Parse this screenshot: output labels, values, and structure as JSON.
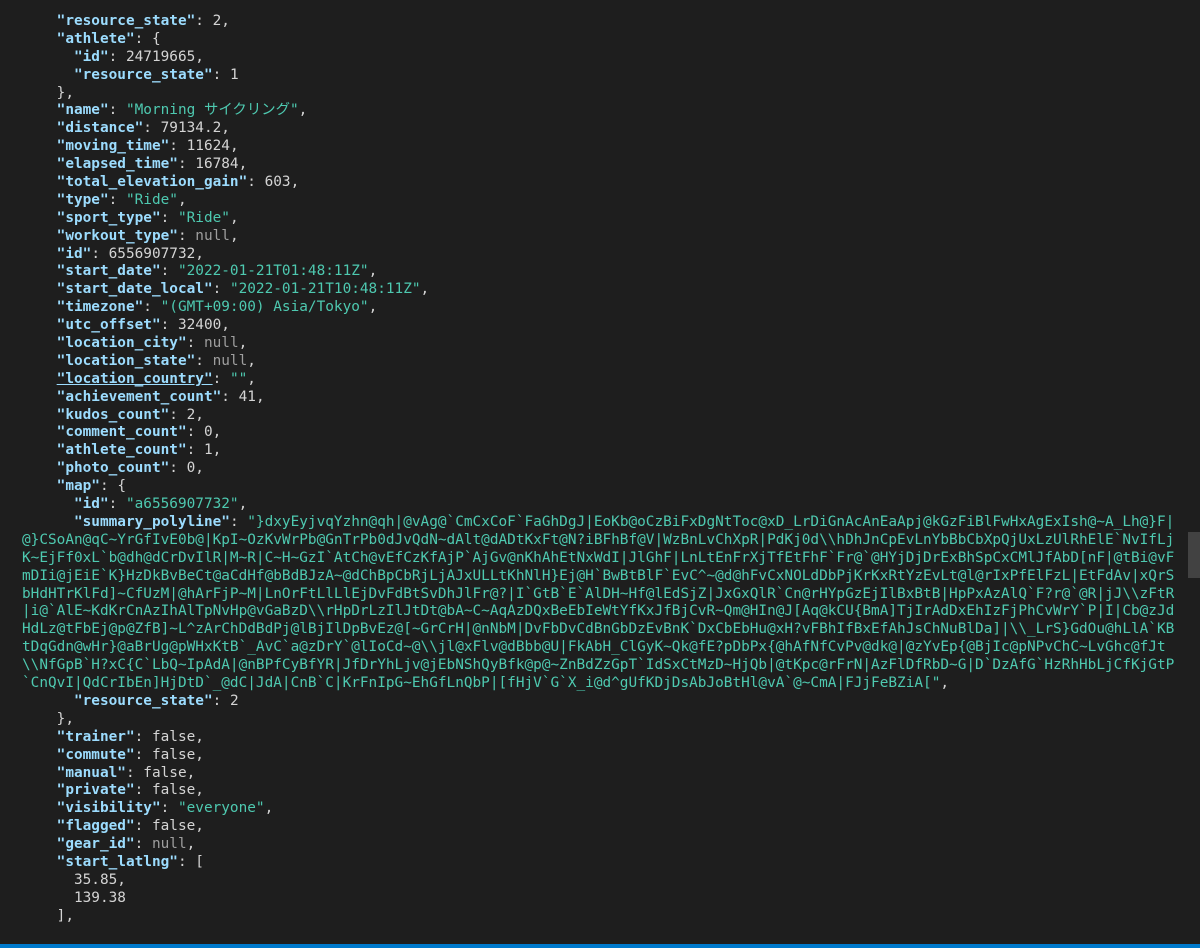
{
  "lines": [
    {
      "indent": "    ",
      "key": "\"resource_state\"",
      "sep": ": ",
      "value": "2",
      "vtype": "n",
      "tail": ","
    },
    {
      "indent": "    ",
      "key": "\"athlete\"",
      "sep": ": ",
      "value": "{",
      "vtype": "p",
      "tail": ""
    },
    {
      "indent": "      ",
      "key": "\"id\"",
      "sep": ": ",
      "value": "24719665",
      "vtype": "n",
      "tail": ","
    },
    {
      "indent": "      ",
      "key": "\"resource_state\"",
      "sep": ": ",
      "value": "1",
      "vtype": "n",
      "tail": ""
    },
    {
      "indent": "    ",
      "key": "",
      "sep": "",
      "value": "},",
      "vtype": "p",
      "tail": ""
    },
    {
      "indent": "    ",
      "key": "\"name\"",
      "sep": ": ",
      "value": "\"Morning サイクリング\"",
      "vtype": "s",
      "tail": ","
    },
    {
      "indent": "    ",
      "key": "\"distance\"",
      "sep": ": ",
      "value": "79134.2",
      "vtype": "n",
      "tail": ","
    },
    {
      "indent": "    ",
      "key": "\"moving_time\"",
      "sep": ": ",
      "value": "11624",
      "vtype": "n",
      "tail": ","
    },
    {
      "indent": "    ",
      "key": "\"elapsed_time\"",
      "sep": ": ",
      "value": "16784",
      "vtype": "n",
      "tail": ","
    },
    {
      "indent": "    ",
      "key": "\"total_elevation_gain\"",
      "sep": ": ",
      "value": "603",
      "vtype": "n",
      "tail": ","
    },
    {
      "indent": "    ",
      "key": "\"type\"",
      "sep": ": ",
      "value": "\"Ride\"",
      "vtype": "s",
      "tail": ","
    },
    {
      "indent": "    ",
      "key": "\"sport_type\"",
      "sep": ": ",
      "value": "\"Ride\"",
      "vtype": "s",
      "tail": ","
    },
    {
      "indent": "    ",
      "key": "\"workout_type\"",
      "sep": ": ",
      "value": "null",
      "vtype": "nl",
      "tail": ","
    },
    {
      "indent": "    ",
      "key": "\"id\"",
      "sep": ": ",
      "value": "6556907732",
      "vtype": "n",
      "tail": ","
    },
    {
      "indent": "    ",
      "key": "\"start_date\"",
      "sep": ": ",
      "value": "\"2022-01-21T01:48:11Z\"",
      "vtype": "s",
      "tail": ","
    },
    {
      "indent": "    ",
      "key": "\"start_date_local\"",
      "sep": ": ",
      "value": "\"2022-01-21T10:48:11Z\"",
      "vtype": "s",
      "tail": ","
    },
    {
      "indent": "    ",
      "key": "\"timezone\"",
      "sep": ": ",
      "value": "\"(GMT+09:00) Asia/Tokyo\"",
      "vtype": "s",
      "tail": ","
    },
    {
      "indent": "    ",
      "key": "\"utc_offset\"",
      "sep": ": ",
      "value": "32400",
      "vtype": "n",
      "tail": ","
    },
    {
      "indent": "    ",
      "key": "\"location_city\"",
      "sep": ": ",
      "value": "null",
      "vtype": "nl",
      "tail": ","
    },
    {
      "indent": "    ",
      "key": "\"location_state\"",
      "sep": ": ",
      "value": "null",
      "vtype": "nl",
      "tail": ","
    },
    {
      "indent": "    ",
      "key": "\"location_country\"",
      "sep": ": ",
      "value": "\"\"",
      "vtype": "s",
      "tail": ",",
      "underline": true
    },
    {
      "indent": "    ",
      "key": "\"achievement_count\"",
      "sep": ": ",
      "value": "41",
      "vtype": "n",
      "tail": ","
    },
    {
      "indent": "    ",
      "key": "\"kudos_count\"",
      "sep": ": ",
      "value": "2",
      "vtype": "n",
      "tail": ","
    },
    {
      "indent": "    ",
      "key": "\"comment_count\"",
      "sep": ": ",
      "value": "0",
      "vtype": "n",
      "tail": ","
    },
    {
      "indent": "    ",
      "key": "\"athlete_count\"",
      "sep": ": ",
      "value": "1",
      "vtype": "n",
      "tail": ","
    },
    {
      "indent": "    ",
      "key": "\"photo_count\"",
      "sep": ": ",
      "value": "0",
      "vtype": "n",
      "tail": ","
    },
    {
      "indent": "    ",
      "key": "\"map\"",
      "sep": ": ",
      "value": "{",
      "vtype": "p",
      "tail": ""
    },
    {
      "indent": "      ",
      "key": "\"id\"",
      "sep": ": ",
      "value": "\"a6556907732\"",
      "vtype": "s",
      "tail": ","
    }
  ],
  "polyline": {
    "indent": "      ",
    "key": "\"summary_polyline\"",
    "sep": ": ",
    "value": "\"}dxyEyjvqYzhn@qh|@vAg@`CmCxCoF`FaGhDgJ|EoKb@oCzBiFxDgNtToc@xD_LrDiGnAcAnEaApj@kGzFiBlFwHxAgExIsh@~A_Lh@}F|@}CSoAn@qC~YrGfIvE0b@|KpI~OzKvWrPb@GnTrPb0dJvQdN~dAlt@dADtKxFt@N?iBFhBf@V|WzBnLvChXpR|PdKj0d\\\\hDhJnCpEvLnYbBbCbXpQjUxLzUlRhElE`NvIfLjK~EjFf0xL`b@dh@dCrDvIlR|M~R|C~H~GzI`AtCh@vEfCzKfAjP`AjGv@nKhAhEtNxWdI|JlGhF|LnLtEnFrXjTfEtFhF`Fr@`@HYjDjDrExBhSpCxCMlJfAbD[nF|@tBi@vFmDIi@jEiE`K}HzDkBvBeCt@aCdHf@bBdBJzA~@dChBpCbRjLjAJxULLtKhNlH}Ej@H`BwBtBlF`EvC^~@d@hFvCxNOLdDbPjKrKxRtYzEvLt@l@rIxPfElFzL|EtFdAv|xQrSbHdHTrKlFd]~CfUzM|@hArFjP~M|LnOrFtLlLlEjDvFdBtSvDhJlFr@?|I`GtB`E`AlDH~Hf@lEdSjZ|JxGxQlR`Cn@rHYpGzEjIlBxBtB|HpPxAzAlQ`F?r@`@R|jJ\\\\zFtR|i@`AlE~KdKrCnAzIhAlTpNvHp@vGaBzD\\\\rHpDrLzIlJtDt@bA~C~AqAzDQxBeEbIeWtYfKxJfBjCvR~Qm@HIn@J[Aq@kCU{BmA]TjIrAdDxEhIzFjPhCvWrY`P|I|Cb@zJdHdLz@tFbEj@p@ZfB]~L^zArChDdBdPj@lBjIlDpBvEz@[~GrCrH|@nNbM|DvFbDvCdBnGbDzEvBnK`DxCbEbHu@xH?vFBhIfBxEfAhJsChNuBlDa]|\\\\_LrS}GdOu@hLlA`KBtDqGdn@wHr}@aBrUg@pWHxKtB`_AvC`a@zDrY`@lIoCd~@\\\\jl@xFlv@dBbb@U|FkAbH_ClGyK~Qk@fE?pDbPx{@hAfNfCvPv@dk@|@zYvEp{@BjIc@pNPvChC~LvGhc@fJt\\\\NfGpB`H?xC{C`LbQ~IpAdA|@nBPfCyBfYR|JfDrYhLjv@jEbNShQyBfk@p@~ZnBdZzGpT`IdSxCtMzD~HjQb|@tKpc@rFrN|AzFlDfRbD~G|D`DzAfG`HzRhHbLjCfKjGtP`CnQvI|QdCrIbEn]HjDtD`_@dC|JdA|CnB`C|KrFnIpG~EhGfLnQbP|[fHjV`G`X_i@d^gUfKDjDsAbJoBtHl@vA`@~CmA|FJjFeBZiA[\"",
    "tail": ","
  },
  "lines_after": [
    {
      "indent": "      ",
      "key": "\"resource_state\"",
      "sep": ": ",
      "value": "2",
      "vtype": "n",
      "tail": ""
    },
    {
      "indent": "    ",
      "key": "",
      "sep": "",
      "value": "},",
      "vtype": "p",
      "tail": ""
    },
    {
      "indent": "    ",
      "key": "\"trainer\"",
      "sep": ": ",
      "value": "false",
      "vtype": "n",
      "tail": ","
    },
    {
      "indent": "    ",
      "key": "\"commute\"",
      "sep": ": ",
      "value": "false",
      "vtype": "n",
      "tail": ","
    },
    {
      "indent": "    ",
      "key": "\"manual\"",
      "sep": ": ",
      "value": "false",
      "vtype": "n",
      "tail": ","
    },
    {
      "indent": "    ",
      "key": "\"private\"",
      "sep": ": ",
      "value": "false",
      "vtype": "n",
      "tail": ","
    },
    {
      "indent": "    ",
      "key": "\"visibility\"",
      "sep": ": ",
      "value": "\"everyone\"",
      "vtype": "s",
      "tail": ","
    },
    {
      "indent": "    ",
      "key": "\"flagged\"",
      "sep": ": ",
      "value": "false",
      "vtype": "n",
      "tail": ","
    },
    {
      "indent": "    ",
      "key": "\"gear_id\"",
      "sep": ": ",
      "value": "null",
      "vtype": "nl",
      "tail": ","
    },
    {
      "indent": "    ",
      "key": "\"start_latlng\"",
      "sep": ": ",
      "value": "[",
      "vtype": "p",
      "tail": ""
    },
    {
      "indent": "      ",
      "key": "",
      "sep": "",
      "value": "35.85,",
      "vtype": "n",
      "tail": ""
    },
    {
      "indent": "      ",
      "key": "",
      "sep": "",
      "value": "139.38",
      "vtype": "n",
      "tail": ""
    },
    {
      "indent": "    ",
      "key": "",
      "sep": "",
      "value": "],",
      "vtype": "p",
      "tail": ""
    }
  ],
  "theme": {
    "background": "#1e1e1e",
    "key_color": "#9cdcfe",
    "string_color": "#4ec9b0",
    "number_color": "#d4d4d4",
    "null_color": "#9e9e9e",
    "accent": "#007acc"
  }
}
